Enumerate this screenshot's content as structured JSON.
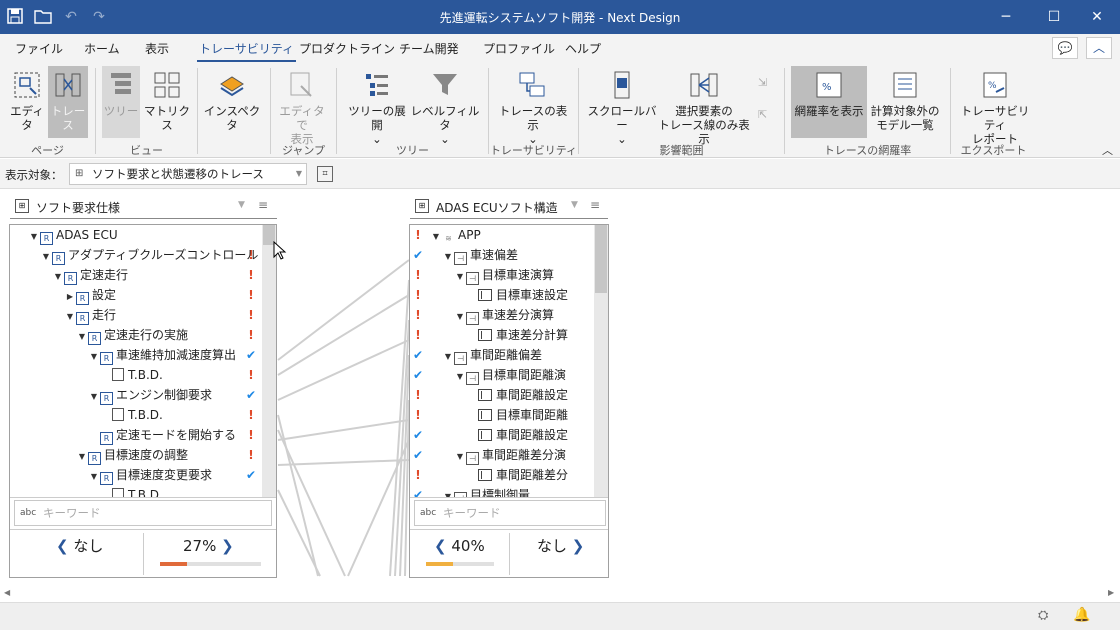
{
  "window": {
    "title": "先進運転システムソフト開発 - Next Design"
  },
  "menu": [
    "ファイル",
    "ホーム",
    "表示",
    "トレーサビリティ",
    "プロダクトライン",
    "チーム開発",
    "プロファイル",
    "ヘルプ"
  ],
  "ribbon": {
    "editor": "エディタ",
    "trace": "トレース",
    "tree": "ツリー",
    "matrix": "マトリクス",
    "inspector": "インスペクタ",
    "jump_line1": "エディタで",
    "jump_line2": "表示",
    "tree_expand": "ツリーの展開",
    "level_filter": "レベルフィルタ",
    "trace_show": "トレースの表示",
    "scrollbar": "スクロールバー",
    "sel_line1": "選択要素の",
    "sel_line2": "トレース線のみ表示",
    "coverage": "網羅率を表示",
    "exclude_line1": "計算対象外の",
    "exclude_line2": "モデル一覧",
    "report_line1": "トレーサビリティ",
    "report_line2": "レポート",
    "groups": {
      "page": "ページ",
      "view": "ビュー",
      "jump": "ジャンプ",
      "tree": "ツリー",
      "trace": "トレーサビリティ",
      "impact": "影響範囲",
      "coverage": "トレースの網羅率",
      "export": "エクスポート"
    }
  },
  "target": {
    "label": "表示対象：",
    "value": "ソフト要求と状態遷移のトレース"
  },
  "left_panel": {
    "title": "ソフト要求仕様",
    "rows": [
      {
        "text": "ADAS ECU",
        "level": 0,
        "caret": "▼",
        "icon": "R",
        "mark": ""
      },
      {
        "text": "アダプティブクルーズコントロール",
        "level": 1,
        "caret": "▼",
        "icon": "R",
        "mark": "!"
      },
      {
        "text": "定速走行",
        "level": 2,
        "caret": "▼",
        "icon": "R",
        "mark": "!"
      },
      {
        "text": "設定",
        "level": 3,
        "caret": "▶",
        "icon": "R",
        "mark": "!"
      },
      {
        "text": "走行",
        "level": 3,
        "caret": "▼",
        "icon": "R",
        "mark": "!"
      },
      {
        "text": "定速走行の実施",
        "level": 4,
        "caret": "▼",
        "icon": "R",
        "mark": "!"
      },
      {
        "text": "車速維持加減速度算出",
        "level": 5,
        "caret": "▼",
        "icon": "R",
        "mark": "✔"
      },
      {
        "text": "T.B.D.",
        "level": 6,
        "caret": "",
        "icon": "N",
        "mark": "!"
      },
      {
        "text": "エンジン制御要求",
        "level": 5,
        "caret": "▼",
        "icon": "R",
        "mark": "✔"
      },
      {
        "text": "T.B.D.",
        "level": 6,
        "caret": "",
        "icon": "N",
        "mark": "!"
      },
      {
        "text": "定速モードを開始する",
        "level": 5,
        "caret": "",
        "icon": "R",
        "mark": "!"
      },
      {
        "text": "目標速度の調整",
        "level": 4,
        "caret": "▼",
        "icon": "R",
        "mark": "!"
      },
      {
        "text": "目標速度変更要求",
        "level": 5,
        "caret": "▼",
        "icon": "R",
        "mark": "✔"
      },
      {
        "text": "T.B.D.",
        "level": 6,
        "caret": "",
        "icon": "N",
        "mark": ""
      }
    ],
    "keyword_placeholder": "キーワード",
    "nav_left": "なし",
    "nav_right": "27%",
    "progress": 0.27,
    "progress_color": "#e06a3a"
  },
  "right_panel": {
    "title": "ADAS ECUソフト構造",
    "rows": [
      {
        "text": "APP",
        "level": 0,
        "caret": "▼",
        "icon": "L",
        "mark": "!"
      },
      {
        "text": "車速偏差",
        "level": 1,
        "caret": "▼",
        "icon": "C",
        "mark": "✔"
      },
      {
        "text": "目標車速演算",
        "level": 2,
        "caret": "▼",
        "icon": "C",
        "mark": "!"
      },
      {
        "text": "目標車速設定",
        "level": 3,
        "caret": "",
        "icon": "B",
        "mark": "!"
      },
      {
        "text": "車速差分演算",
        "level": 2,
        "caret": "▼",
        "icon": "C",
        "mark": "!"
      },
      {
        "text": "車速差分計算",
        "level": 3,
        "caret": "",
        "icon": "B",
        "mark": "!"
      },
      {
        "text": "車間距離偏差",
        "level": 1,
        "caret": "▼",
        "icon": "C",
        "mark": "✔"
      },
      {
        "text": "目標車間距離演",
        "level": 2,
        "caret": "▼",
        "icon": "C",
        "mark": "✔"
      },
      {
        "text": "車間距離設定",
        "level": 3,
        "caret": "",
        "icon": "B",
        "mark": "!"
      },
      {
        "text": "目標車間距離",
        "level": 3,
        "caret": "",
        "icon": "B",
        "mark": "!"
      },
      {
        "text": "車間距離設定",
        "level": 3,
        "caret": "",
        "icon": "B",
        "mark": "✔"
      },
      {
        "text": "車間距離差分演",
        "level": 2,
        "caret": "▼",
        "icon": "C",
        "mark": "✔"
      },
      {
        "text": "車間距離差分",
        "level": 3,
        "caret": "",
        "icon": "B",
        "mark": "!"
      },
      {
        "text": "目標制御量",
        "level": 1,
        "caret": "▼",
        "icon": "C",
        "mark": "✔"
      }
    ],
    "keyword_placeholder": "キーワード",
    "nav_left": "40%",
    "nav_right": "なし",
    "progress": 0.4,
    "progress_color": "#f0b040"
  },
  "colors": {
    "titlebar": "#2b579a",
    "warn": "#e04a2a",
    "ok": "#1e88e5",
    "trace_line": "#cfcfcf"
  }
}
